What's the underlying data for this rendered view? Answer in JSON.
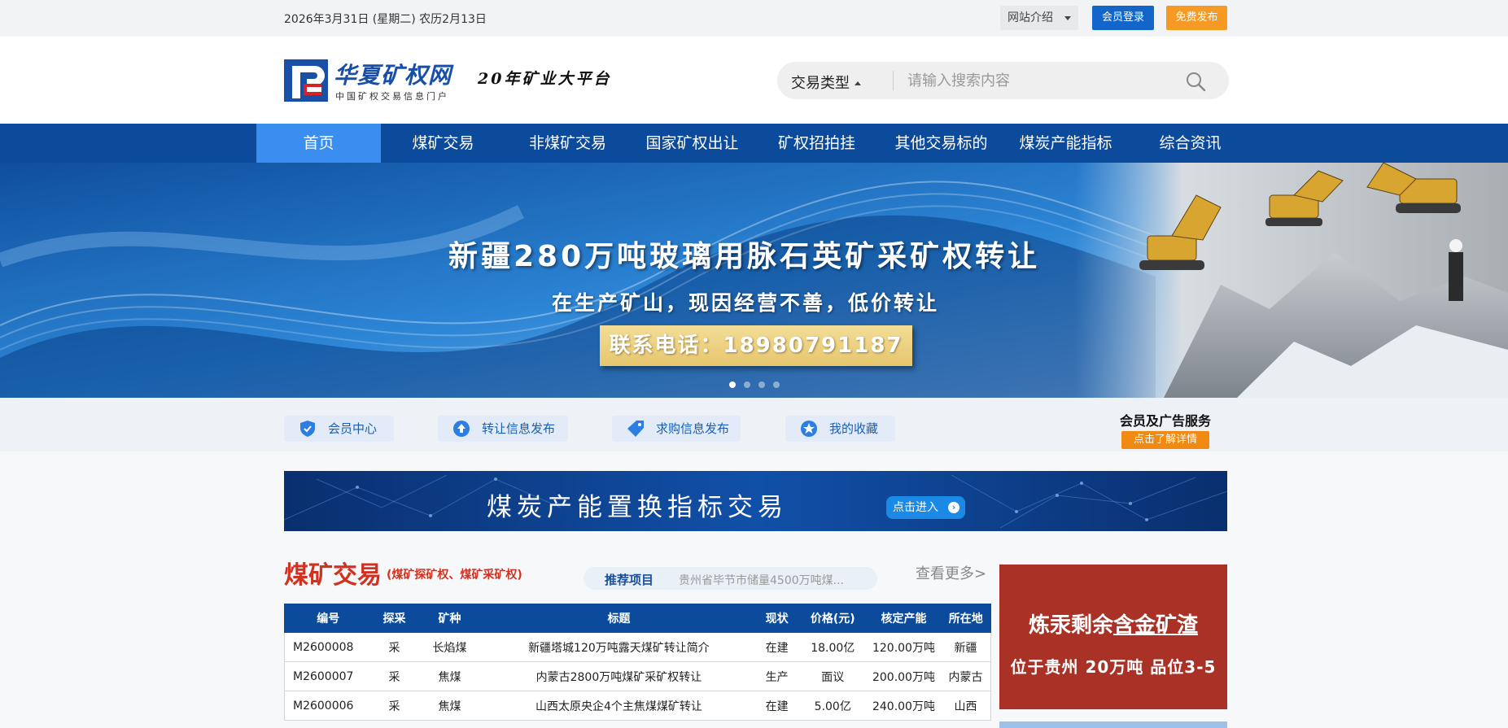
{
  "topbar": {
    "date": "2026年3月31日 (星期二) 农历2月13日",
    "site_intro": "网站介绍",
    "login": "会员登录",
    "publish": "免费发布"
  },
  "header": {
    "logo_title": "华夏矿权网",
    "logo_sub": "中国矿权交易信息门户",
    "slogan": "20年矿业大平台",
    "search_type": "交易类型",
    "search_placeholder": "请输入搜索内容"
  },
  "nav": {
    "items": [
      "首页",
      "煤矿交易",
      "非煤矿交易",
      "国家矿权出让",
      "矿权招拍挂",
      "其他交易标的",
      "煤炭产能指标",
      "综合资讯"
    ],
    "active_index": 0
  },
  "banner": {
    "title": "新疆280万吨玻璃用脉石英矿采矿权转让",
    "subtitle": "在生产矿山，现因经营不善，低价转让",
    "phone": "联系电话：18980791187",
    "slides": 4,
    "current_slide": 0
  },
  "quick_links": [
    {
      "label": "会员中心",
      "icon": "shield-icon"
    },
    {
      "label": "转让信息发布",
      "icon": "upload-icon"
    },
    {
      "label": "求购信息发布",
      "icon": "tag-icon"
    },
    {
      "label": "我的收藏",
      "icon": "star-icon"
    }
  ],
  "member_service": {
    "title": "会员及广告服务",
    "button": "点击了解详情"
  },
  "capacity_banner": {
    "title": "煤炭产能置换指标交易",
    "button": "点击进入"
  },
  "coal_section": {
    "title": "煤矿交易",
    "subtitle": "(煤矿探矿权、煤矿采矿权)",
    "recommend_label": "推荐项目",
    "recommend_value": "贵州省毕节市储量4500万吨煤...",
    "more": "查看更多>",
    "columns": [
      "编号",
      "探采",
      "矿种",
      "标题",
      "现状",
      "价格(元)",
      "核定产能",
      "所在地"
    ],
    "rows": [
      [
        "M2600008",
        "采",
        "长焰煤",
        "新疆塔城120万吨露天煤矿转让简介",
        "在建",
        "18.00亿",
        "120.00万吨",
        "新疆"
      ],
      [
        "M2600007",
        "采",
        "焦煤",
        "内蒙古2800万吨煤矿采矿权转让",
        "生产",
        "面议",
        "200.00万吨",
        "内蒙古"
      ],
      [
        "M2600006",
        "采",
        "焦煤",
        "山西太原央企4个主焦煤煤矿转让",
        "在建",
        "5.00亿",
        "240.00万吨",
        "山西"
      ]
    ]
  },
  "side_ad": {
    "line1_prefix": "炼汞剩余",
    "line1_underlined": "含金矿渣",
    "line2": "位于贵州  20万吨  品位3-5"
  },
  "colors": {
    "nav_bg": "#0c4a9c",
    "nav_active": "#3a8ef0",
    "accent_red": "#d2311f",
    "orange": "#f79a23"
  }
}
